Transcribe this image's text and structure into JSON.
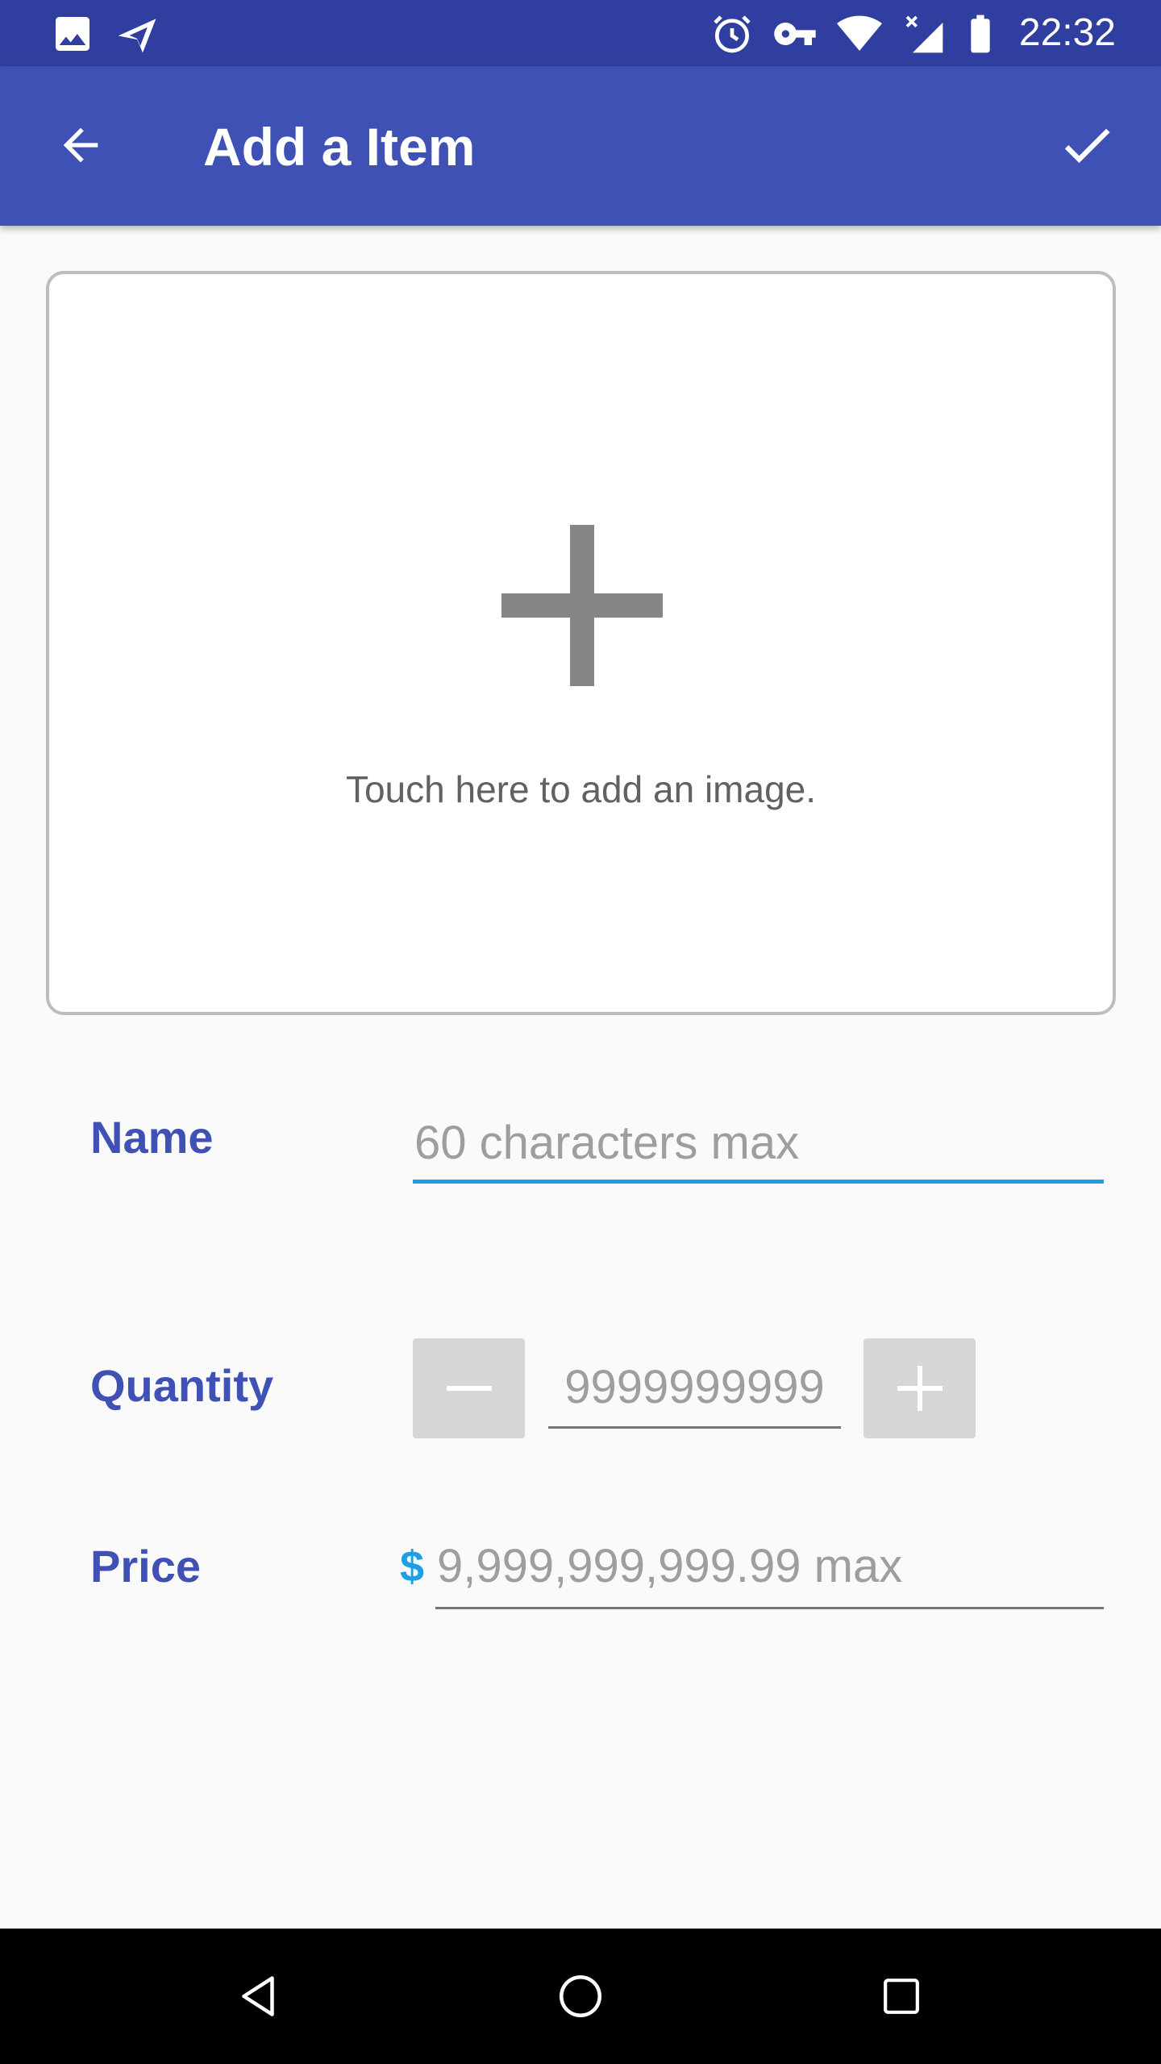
{
  "status_bar": {
    "time": "22:32",
    "left_icons": [
      "image-icon",
      "send-icon"
    ],
    "right_icons": [
      "alarm-icon",
      "key-icon",
      "wifi-icon",
      "signal-icon",
      "battery-icon"
    ]
  },
  "app_bar": {
    "title": "Add a Item",
    "back_icon": "arrow-back-icon",
    "confirm_icon": "check-icon",
    "color": "#3f51b5"
  },
  "image_picker": {
    "hint": "Touch here to add an image.",
    "icon": "plus-icon"
  },
  "form": {
    "name": {
      "label": "Name",
      "placeholder": "60 characters max",
      "value": ""
    },
    "quantity": {
      "label": "Quantity",
      "placeholder": "9999999999",
      "value": "",
      "decrement_icon": "minus-icon",
      "increment_icon": "plus-icon"
    },
    "price": {
      "label": "Price",
      "currency": "$",
      "placeholder": "9,999,999,999.99 max",
      "value": ""
    }
  },
  "colors": {
    "primary": "#3f51b5",
    "primary_dark": "#303f9f",
    "accent": "#1e9ee6"
  },
  "nav_bar": {
    "buttons": [
      "nav-back-icon",
      "nav-home-icon",
      "nav-recents-icon"
    ]
  }
}
